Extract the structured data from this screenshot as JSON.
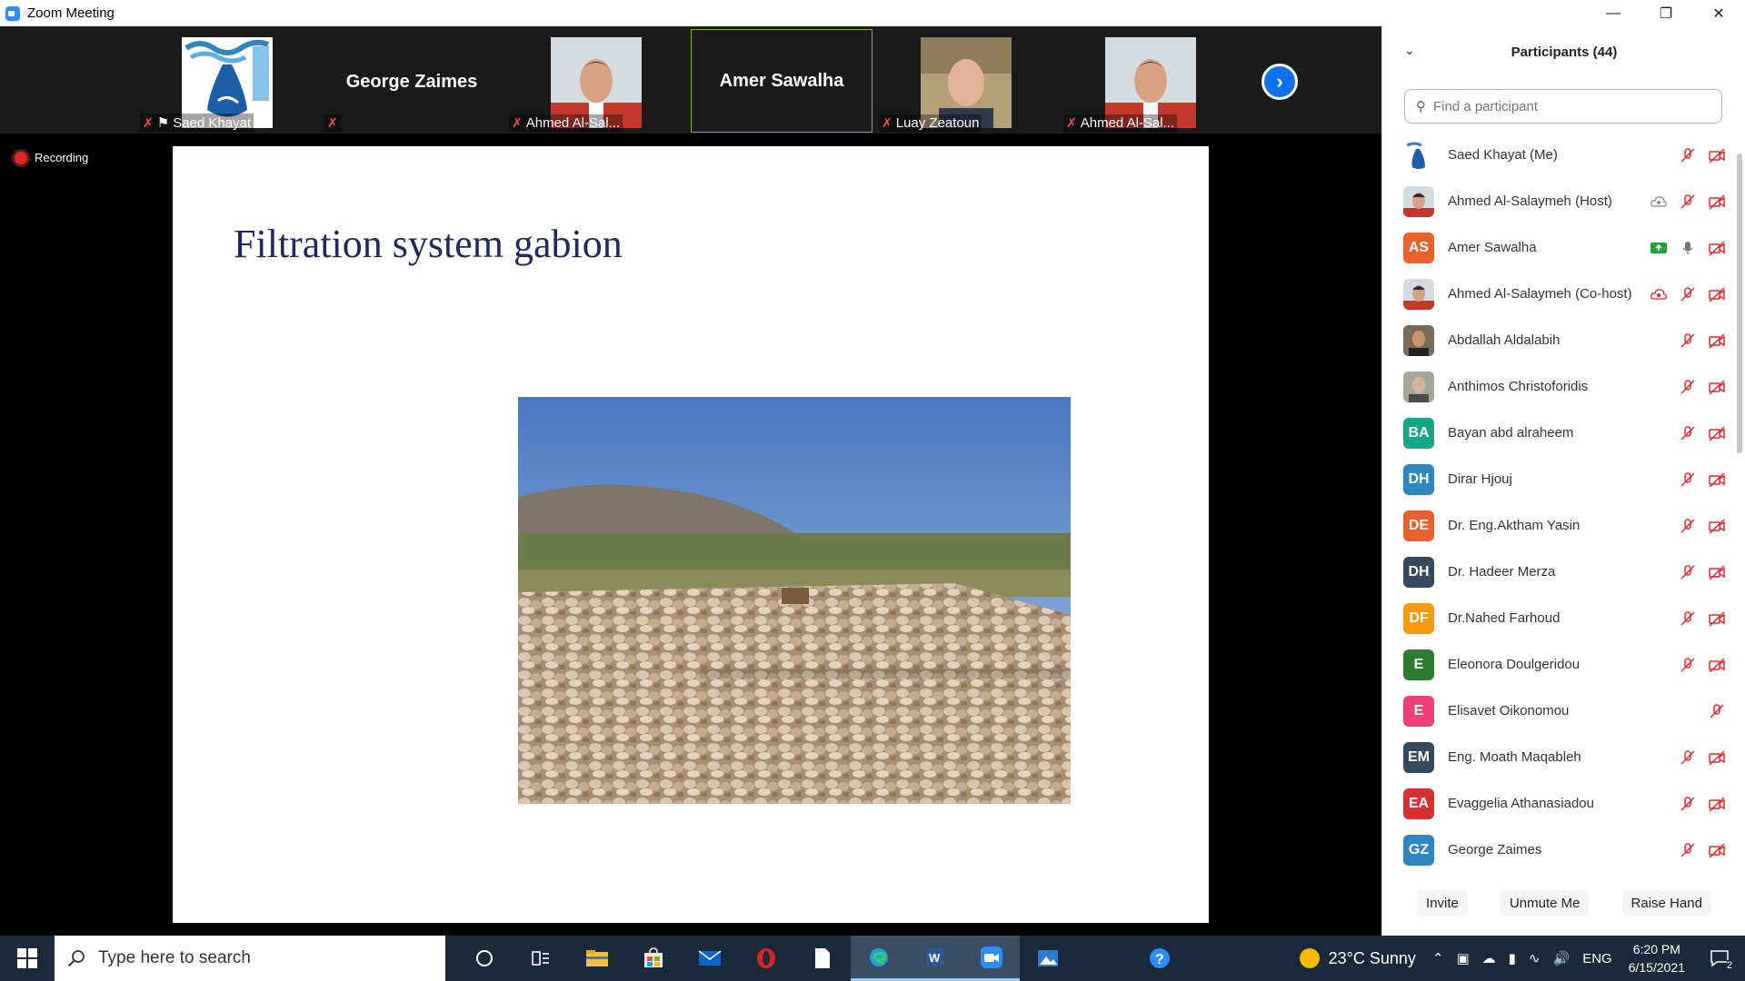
{
  "window": {
    "title": "Zoom Meeting"
  },
  "strip": {
    "tiles": [
      {
        "label": "Saed Khayat",
        "kind": "image"
      },
      {
        "label": "George Zaimes",
        "kind": "name"
      },
      {
        "label": "Ahmed Al-Sal...",
        "kind": "image"
      },
      {
        "label": "Amer Sawalha",
        "kind": "name"
      },
      {
        "label": "Luay Zeatoun",
        "kind": "image"
      },
      {
        "label": "Ahmed Al-Sal...",
        "kind": "image"
      }
    ]
  },
  "recording": {
    "label": "Recording"
  },
  "slide": {
    "title": "Filtration system gabion"
  },
  "panel": {
    "header": "Participants (44)",
    "search_placeholder": "Find a participant",
    "participants": [
      {
        "name": "Saed Khayat (Me)",
        "initials": "",
        "color": "#ffffff"
      },
      {
        "name": "Ahmed Al-Salaymeh (Host)",
        "initials": "",
        "color": "#ffffff"
      },
      {
        "name": "Amer Sawalha",
        "initials": "AS",
        "color": "#e8612c"
      },
      {
        "name": "Ahmed Al-Salaymeh (Co-host)",
        "initials": "",
        "color": "#ffffff"
      },
      {
        "name": "Abdallah Aldalabih",
        "initials": "",
        "color": "#6b5a4a"
      },
      {
        "name": "Anthimos Christoforidis",
        "initials": "",
        "color": "#8a8a7a"
      },
      {
        "name": "Bayan abd  alraheem",
        "initials": "BA",
        "color": "#17a589"
      },
      {
        "name": "Dirar Hjouj",
        "initials": "DH",
        "color": "#2e86c1"
      },
      {
        "name": "Dr. Eng.Aktham Yasin",
        "initials": "DE",
        "color": "#e8612c"
      },
      {
        "name": "Dr. Hadeer Merza",
        "initials": "DH",
        "color": "#34495e"
      },
      {
        "name": "Dr.Nahed Farhoud",
        "initials": "DF",
        "color": "#f39c12"
      },
      {
        "name": "Eleonora Doulgeridou",
        "initials": "E",
        "color": "#2e7d32"
      },
      {
        "name": "Elisavet Oikonomou",
        "initials": "E",
        "color": "#ec407a"
      },
      {
        "name": "Eng. Moath Maqableh",
        "initials": "EM",
        "color": "#34495e"
      },
      {
        "name": "Evaggelia Athanasiadou",
        "initials": "EA",
        "color": "#d63031"
      },
      {
        "name": "George Zaimes",
        "initials": "GZ",
        "color": "#2e86c1"
      }
    ],
    "buttons": {
      "invite": "Invite",
      "unmute": "Unmute Me",
      "raise_hand": "Raise Hand"
    }
  },
  "taskbar": {
    "search_placeholder": "Type here to search",
    "weather": "23°C  Sunny",
    "language": "ENG",
    "time": "6:20 PM",
    "date": "6/15/2021",
    "notifications": "2"
  }
}
